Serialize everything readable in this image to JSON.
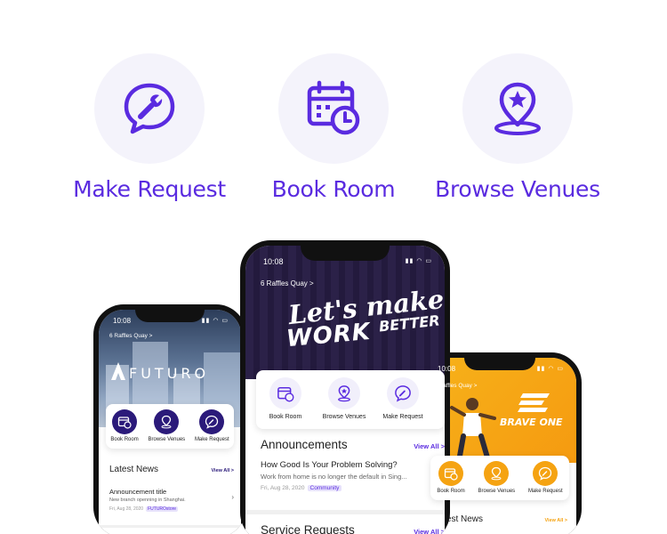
{
  "features": [
    {
      "label": "Make Request",
      "icon": "wrench-chat-icon"
    },
    {
      "label": "Book Room",
      "icon": "calendar-clock-icon"
    },
    {
      "label": "Browse Venues",
      "icon": "star-pin-icon"
    }
  ],
  "colors": {
    "accent": "#5a2be0",
    "circle_bg": "#f4f3fb",
    "left_theme": "#2b1a7a",
    "right_theme": "#f5a312"
  },
  "phone_left": {
    "time": "10:08",
    "location": "6 Raffles Quay >",
    "brand": "FUTURO",
    "actions": [
      {
        "label": "Book Room",
        "icon": "calendar-clock-icon"
      },
      {
        "label": "Browse Venues",
        "icon": "star-pin-icon"
      },
      {
        "label": "Make Request",
        "icon": "wrench-chat-icon"
      }
    ],
    "news_title": "Latest News",
    "view_all": "View All >",
    "news": {
      "title": "Announcement title",
      "desc": "New branch openning in Shanghai.",
      "date": "Fri, Aug 28, 2020",
      "tag": "FUTUROstore"
    }
  },
  "phone_mid": {
    "time": "10:08",
    "location": "6 Raffles Quay >",
    "hero_line1": "Let's make",
    "hero_line2": "WORK",
    "hero_line3": "BETTER",
    "actions": [
      {
        "label": "Book Room",
        "icon": "calendar-clock-icon"
      },
      {
        "label": "Browse Venues",
        "icon": "star-pin-icon"
      },
      {
        "label": "Make Request",
        "icon": "wrench-chat-icon"
      }
    ],
    "announcements_title": "Announcements",
    "view_all": "View All >",
    "announcement": {
      "title": "How Good Is Your Problem Solving?",
      "desc": "Work from home is no longer the default in Sing...",
      "date": "Fri, Aug 28, 2020",
      "tag": "Community"
    },
    "service_title": "Service Requests"
  },
  "phone_right": {
    "time": "10:08",
    "location": "6 Raffles Quay >",
    "brand": "BRAVE ONE",
    "actions": [
      {
        "label": "Book Room",
        "icon": "calendar-clock-icon"
      },
      {
        "label": "Browse Venues",
        "icon": "star-pin-icon"
      },
      {
        "label": "Make Request",
        "icon": "wrench-chat-icon"
      }
    ],
    "news_title": "Latest News",
    "view_all": "View All >"
  }
}
